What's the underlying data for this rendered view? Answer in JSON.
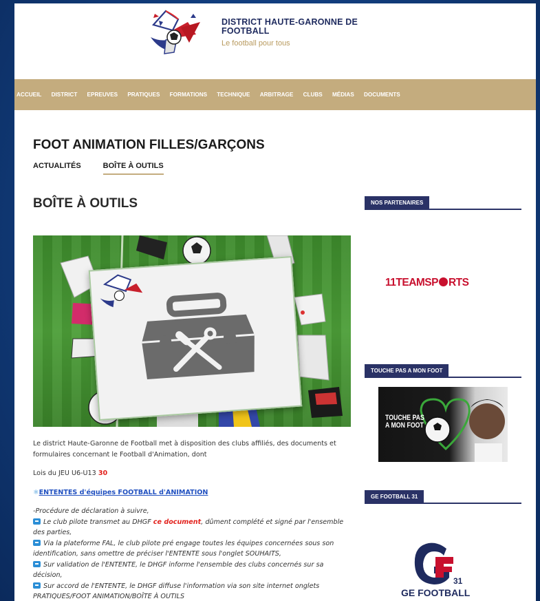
{
  "site": {
    "title_line1": "DISTRICT HAUTE-GARONNE DE",
    "title_line2": "FOOTBALL",
    "tagline": "Le football pour tous"
  },
  "nav": {
    "items": [
      "ACCUEIL",
      "DISTRICT",
      "EPREUVES",
      "PRATIQUES",
      "FORMATIONS",
      "TECHNIQUE",
      "ARBITRAGE",
      "CLUBS",
      "MÉDIAS",
      "DOCUMENTS"
    ]
  },
  "section": {
    "title": "FOOT ANIMATION FILLES/GARÇONS",
    "tabs": [
      {
        "label": "ACTUALITÉS",
        "active": false
      },
      {
        "label": "BOÎTE À OUTILS",
        "active": true
      }
    ]
  },
  "page": {
    "title": "BOÎTE À OUTILS",
    "intro_line1": "Le district Haute-Garonne de Football met à disposition des clubs affiliés, des documents et",
    "intro_line2": "formulaires concernant le Football d'Animation, dont",
    "lois_text": "Lois du JEU U6-U13 ",
    "lois_badge": "30",
    "ententes_link": "ENTENTES d'équipes FOOTBALL d'ANIMATION",
    "procedure": "-Procédure de déclaration à suivre,",
    "step1_a": "Le club pilote transmet au DHGF ",
    "step1_link": "ce document",
    "step1_b": ", dûment complété et signé par l'ensemble",
    "step1_c": "des parties,",
    "step2_a": "Via la plateforme FAL, le club pilote pré engage toutes les équipes concernées sous son",
    "step2_b": "identification, sans omettre de préciser l'ENTENTE sous l'onglet SOUHAITS,",
    "step3_a": "Sur validation de l'ENTENTE, le DHGF informe l'ensemble des clubs concernés sur sa",
    "step3_b": "décision,",
    "step4_a": "Sur accord de l'ENTENTE, le DHGF diffuse l'information via son site internet onglets",
    "step4_b": "PRATIQUES/FOOT ANIMATION/BOÎTE À OUTILS"
  },
  "sidebar": {
    "partners_title": "NOS PARTENAIRES",
    "partner_name_a": "11TEAMSP",
    "partner_name_b": "RTS",
    "tpmf_title": "TOUCHE PAS A MON FOOT",
    "tpmf_line1": "TOUCHE PAS",
    "tpmf_line2": "A MON FOOT",
    "ge_title": "GE FOOTBALL 31",
    "ge_number": "31",
    "ge_text": "GE FOOTBALL"
  },
  "colors": {
    "nav_bg": "#c4ac7e",
    "navy": "#2a3266",
    "accent_red": "#e2211c",
    "link_blue": "#2050c0"
  }
}
